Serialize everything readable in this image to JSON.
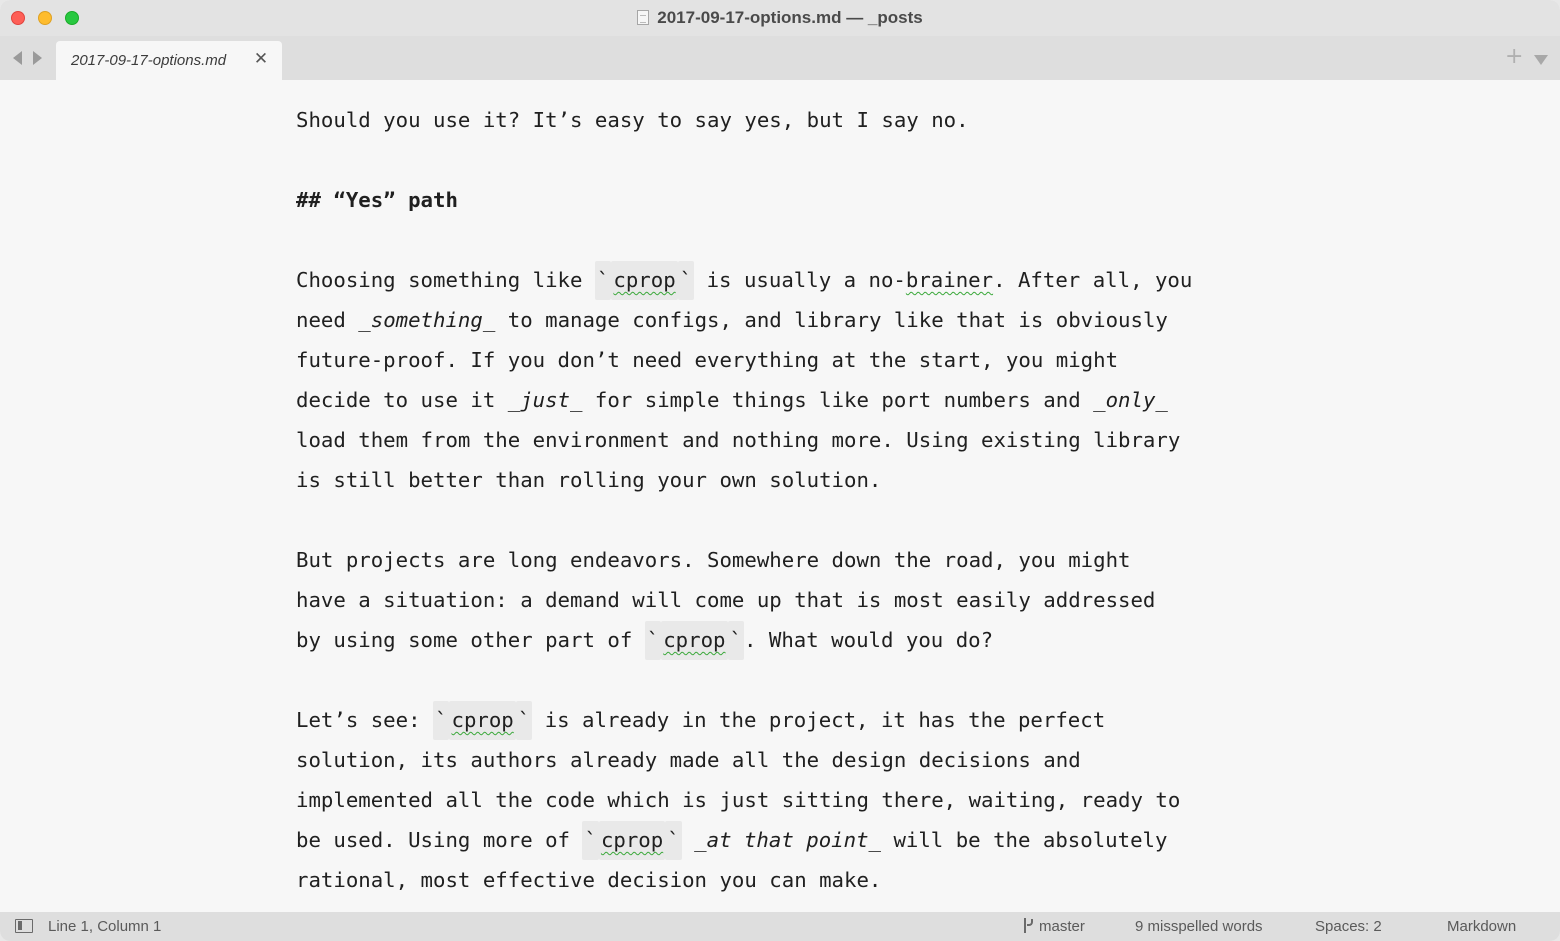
{
  "window": {
    "title": "2017-09-17-options.md — _posts"
  },
  "tabs": [
    {
      "label": "2017-09-17-options.md",
      "active": true
    }
  ],
  "editor": {
    "lines": [
      {
        "segments": [
          {
            "t": "Should you use it? It’s easy to say yes, but I say no."
          }
        ]
      },
      {
        "segments": []
      },
      {
        "segments": [
          {
            "t": "## “Yes” path",
            "style": "bold"
          }
        ]
      },
      {
        "segments": []
      },
      {
        "segments": [
          {
            "t": "Choosing something like "
          },
          {
            "t": "`",
            "style": "code"
          },
          {
            "t": "cprop",
            "style": "code-wavy"
          },
          {
            "t": "`",
            "style": "code"
          },
          {
            "t": " is usually a no-"
          },
          {
            "t": "brainer",
            "style": "wavy"
          },
          {
            "t": ". After all, you"
          }
        ]
      },
      {
        "segments": [
          {
            "t": "need "
          },
          {
            "t": "_something_",
            "style": "italic"
          },
          {
            "t": " to manage configs, and library like that is obviously"
          }
        ]
      },
      {
        "segments": [
          {
            "t": "future-proof. If you don’t need everything at the start, you might"
          }
        ]
      },
      {
        "segments": [
          {
            "t": "decide to use it "
          },
          {
            "t": "_just_",
            "style": "italic"
          },
          {
            "t": " for simple things like port numbers and "
          },
          {
            "t": "_only_",
            "style": "italic"
          }
        ]
      },
      {
        "segments": [
          {
            "t": "load them from the environment and nothing more. Using existing library"
          }
        ]
      },
      {
        "segments": [
          {
            "t": "is still better than rolling your own solution."
          }
        ]
      },
      {
        "segments": []
      },
      {
        "segments": [
          {
            "t": "But projects are long endeavors. Somewhere down the road, you might"
          }
        ]
      },
      {
        "segments": [
          {
            "t": "have a situation: a demand will come up that is most easily addressed"
          }
        ]
      },
      {
        "segments": [
          {
            "t": "by using some other part of "
          },
          {
            "t": "`",
            "style": "code"
          },
          {
            "t": "cprop",
            "style": "code-wavy"
          },
          {
            "t": "`",
            "style": "code"
          },
          {
            "t": ". What would you do?"
          }
        ]
      },
      {
        "segments": []
      },
      {
        "segments": [
          {
            "t": "Let’s see: "
          },
          {
            "t": "`",
            "style": "code"
          },
          {
            "t": "cprop",
            "style": "code-wavy"
          },
          {
            "t": "`",
            "style": "code"
          },
          {
            "t": " is already in the project, it has the perfect"
          }
        ]
      },
      {
        "segments": [
          {
            "t": "solution, its authors already made all the design decisions and"
          }
        ]
      },
      {
        "segments": [
          {
            "t": "implemented all the code which is just sitting there, waiting, ready to"
          }
        ]
      },
      {
        "segments": [
          {
            "t": "be used. Using more of "
          },
          {
            "t": "`",
            "style": "code"
          },
          {
            "t": "cprop",
            "style": "code-wavy"
          },
          {
            "t": "`",
            "style": "code"
          },
          {
            "t": " "
          },
          {
            "t": "_at that point_",
            "style": "italic"
          },
          {
            "t": " will be the absolutely"
          }
        ]
      },
      {
        "segments": [
          {
            "t": "rational, most effective decision you can make."
          }
        ]
      }
    ]
  },
  "statusbar": {
    "position": "Line 1, Column 1",
    "branch": "master",
    "spelling": "9 misspelled words",
    "indentation": "Spaces: 2",
    "syntax": "Markdown"
  },
  "icons": {
    "document": "document-icon",
    "sidebar": "sidebar-toggle-icon",
    "branch": "git-branch-icon",
    "close": "close-icon",
    "plus": "plus-icon",
    "more": "chevron-down-icon"
  }
}
